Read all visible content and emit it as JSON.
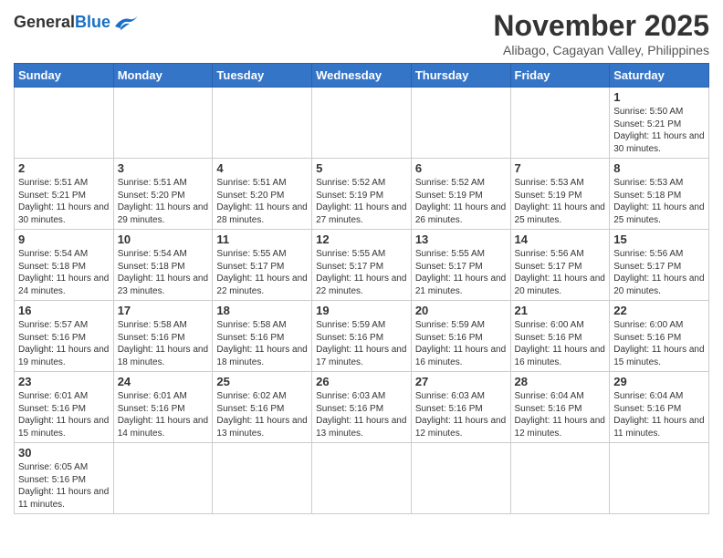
{
  "logo": {
    "general": "General",
    "blue": "Blue"
  },
  "title": "November 2025",
  "subtitle": "Alibago, Cagayan Valley, Philippines",
  "days_of_week": [
    "Sunday",
    "Monday",
    "Tuesday",
    "Wednesday",
    "Thursday",
    "Friday",
    "Saturday"
  ],
  "weeks": [
    [
      {
        "day": "",
        "info": ""
      },
      {
        "day": "",
        "info": ""
      },
      {
        "day": "",
        "info": ""
      },
      {
        "day": "",
        "info": ""
      },
      {
        "day": "",
        "info": ""
      },
      {
        "day": "",
        "info": ""
      },
      {
        "day": "1",
        "info": "Sunrise: 5:50 AM\nSunset: 5:21 PM\nDaylight: 11 hours and 30 minutes."
      }
    ],
    [
      {
        "day": "2",
        "info": "Sunrise: 5:51 AM\nSunset: 5:21 PM\nDaylight: 11 hours and 30 minutes."
      },
      {
        "day": "3",
        "info": "Sunrise: 5:51 AM\nSunset: 5:20 PM\nDaylight: 11 hours and 29 minutes."
      },
      {
        "day": "4",
        "info": "Sunrise: 5:51 AM\nSunset: 5:20 PM\nDaylight: 11 hours and 28 minutes."
      },
      {
        "day": "5",
        "info": "Sunrise: 5:52 AM\nSunset: 5:19 PM\nDaylight: 11 hours and 27 minutes."
      },
      {
        "day": "6",
        "info": "Sunrise: 5:52 AM\nSunset: 5:19 PM\nDaylight: 11 hours and 26 minutes."
      },
      {
        "day": "7",
        "info": "Sunrise: 5:53 AM\nSunset: 5:19 PM\nDaylight: 11 hours and 25 minutes."
      },
      {
        "day": "8",
        "info": "Sunrise: 5:53 AM\nSunset: 5:18 PM\nDaylight: 11 hours and 25 minutes."
      }
    ],
    [
      {
        "day": "9",
        "info": "Sunrise: 5:54 AM\nSunset: 5:18 PM\nDaylight: 11 hours and 24 minutes."
      },
      {
        "day": "10",
        "info": "Sunrise: 5:54 AM\nSunset: 5:18 PM\nDaylight: 11 hours and 23 minutes."
      },
      {
        "day": "11",
        "info": "Sunrise: 5:55 AM\nSunset: 5:17 PM\nDaylight: 11 hours and 22 minutes."
      },
      {
        "day": "12",
        "info": "Sunrise: 5:55 AM\nSunset: 5:17 PM\nDaylight: 11 hours and 22 minutes."
      },
      {
        "day": "13",
        "info": "Sunrise: 5:55 AM\nSunset: 5:17 PM\nDaylight: 11 hours and 21 minutes."
      },
      {
        "day": "14",
        "info": "Sunrise: 5:56 AM\nSunset: 5:17 PM\nDaylight: 11 hours and 20 minutes."
      },
      {
        "day": "15",
        "info": "Sunrise: 5:56 AM\nSunset: 5:17 PM\nDaylight: 11 hours and 20 minutes."
      }
    ],
    [
      {
        "day": "16",
        "info": "Sunrise: 5:57 AM\nSunset: 5:16 PM\nDaylight: 11 hours and 19 minutes."
      },
      {
        "day": "17",
        "info": "Sunrise: 5:58 AM\nSunset: 5:16 PM\nDaylight: 11 hours and 18 minutes."
      },
      {
        "day": "18",
        "info": "Sunrise: 5:58 AM\nSunset: 5:16 PM\nDaylight: 11 hours and 18 minutes."
      },
      {
        "day": "19",
        "info": "Sunrise: 5:59 AM\nSunset: 5:16 PM\nDaylight: 11 hours and 17 minutes."
      },
      {
        "day": "20",
        "info": "Sunrise: 5:59 AM\nSunset: 5:16 PM\nDaylight: 11 hours and 16 minutes."
      },
      {
        "day": "21",
        "info": "Sunrise: 6:00 AM\nSunset: 5:16 PM\nDaylight: 11 hours and 16 minutes."
      },
      {
        "day": "22",
        "info": "Sunrise: 6:00 AM\nSunset: 5:16 PM\nDaylight: 11 hours and 15 minutes."
      }
    ],
    [
      {
        "day": "23",
        "info": "Sunrise: 6:01 AM\nSunset: 5:16 PM\nDaylight: 11 hours and 15 minutes."
      },
      {
        "day": "24",
        "info": "Sunrise: 6:01 AM\nSunset: 5:16 PM\nDaylight: 11 hours and 14 minutes."
      },
      {
        "day": "25",
        "info": "Sunrise: 6:02 AM\nSunset: 5:16 PM\nDaylight: 11 hours and 13 minutes."
      },
      {
        "day": "26",
        "info": "Sunrise: 6:03 AM\nSunset: 5:16 PM\nDaylight: 11 hours and 13 minutes."
      },
      {
        "day": "27",
        "info": "Sunrise: 6:03 AM\nSunset: 5:16 PM\nDaylight: 11 hours and 12 minutes."
      },
      {
        "day": "28",
        "info": "Sunrise: 6:04 AM\nSunset: 5:16 PM\nDaylight: 11 hours and 12 minutes."
      },
      {
        "day": "29",
        "info": "Sunrise: 6:04 AM\nSunset: 5:16 PM\nDaylight: 11 hours and 11 minutes."
      }
    ],
    [
      {
        "day": "30",
        "info": "Sunrise: 6:05 AM\nSunset: 5:16 PM\nDaylight: 11 hours and 11 minutes."
      },
      {
        "day": "",
        "info": ""
      },
      {
        "day": "",
        "info": ""
      },
      {
        "day": "",
        "info": ""
      },
      {
        "day": "",
        "info": ""
      },
      {
        "day": "",
        "info": ""
      },
      {
        "day": "",
        "info": ""
      }
    ]
  ]
}
